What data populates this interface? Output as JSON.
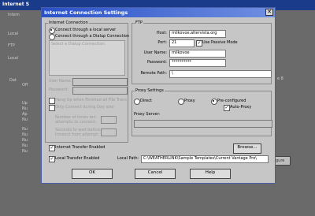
{
  "background": {
    "title": "Internet S",
    "labels": [
      "Intern",
      "Local",
      "FTP",
      "Local",
      "Dat",
      "Off",
      "Up",
      "Nu",
      "Ap",
      "Nu",
      "Nu",
      "Nu",
      "Nu",
      "Nu",
      "Nu"
    ],
    "right_label": "e 8",
    "right_button": "igure"
  },
  "dialog": {
    "title": "Internet Connection Settings",
    "close_glyph": "✕"
  },
  "connection": {
    "group_title": "Internet Connection",
    "local_server_label": "Connect through a local server",
    "dialup_label": "Connect through a Dialup Connection",
    "select_dialup_label": "Select a Dialup Connection:",
    "user_name_label": "User Name:",
    "password_label": "Password:",
    "hangup_label": "Hang Up when Finished all File Trans",
    "only_connect_label": "Only Connect during Day also",
    "wait_label_line1": "Number of times ten",
    "wait_label_line2": "attempts to connect:",
    "seconds_label_line1": "Seconds to wait before",
    "seconds_label_line2": "timeout from attempt:"
  },
  "ftp": {
    "group_title": "FTP",
    "host_label": "Host:",
    "host_value": "milkovoe.altervista.org",
    "port_label": "Port:",
    "port_value": "21",
    "passive_label": "Use Passive Mode",
    "username_label": "User Name:",
    "username_value": "milkovoe",
    "password_label": "Password:",
    "password_value": "**********",
    "remote_path_label": "Remote Path:",
    "remote_path_value": "\\"
  },
  "proxy": {
    "group_title": "Proxy Settings",
    "direct_label": "Direct",
    "proxy_label": "Proxy",
    "preconfigured_label": "Pre-configured",
    "auto_proxy_label": "Auto-Proxy",
    "server_label": "Proxy Server:"
  },
  "bottom": {
    "internet_transfer_label": "Internet Transfer Enabled",
    "browse_label": "Browse...",
    "local_transfer_label": "Local Transfer Enabled",
    "local_path_label": "Local Path:",
    "local_path_value": "C:\\WEATHERLINK\\Sample Templates\\Current Vantage Pro\\"
  },
  "buttons": {
    "ok": "OK",
    "cancel": "Cancel",
    "help": "Help"
  }
}
